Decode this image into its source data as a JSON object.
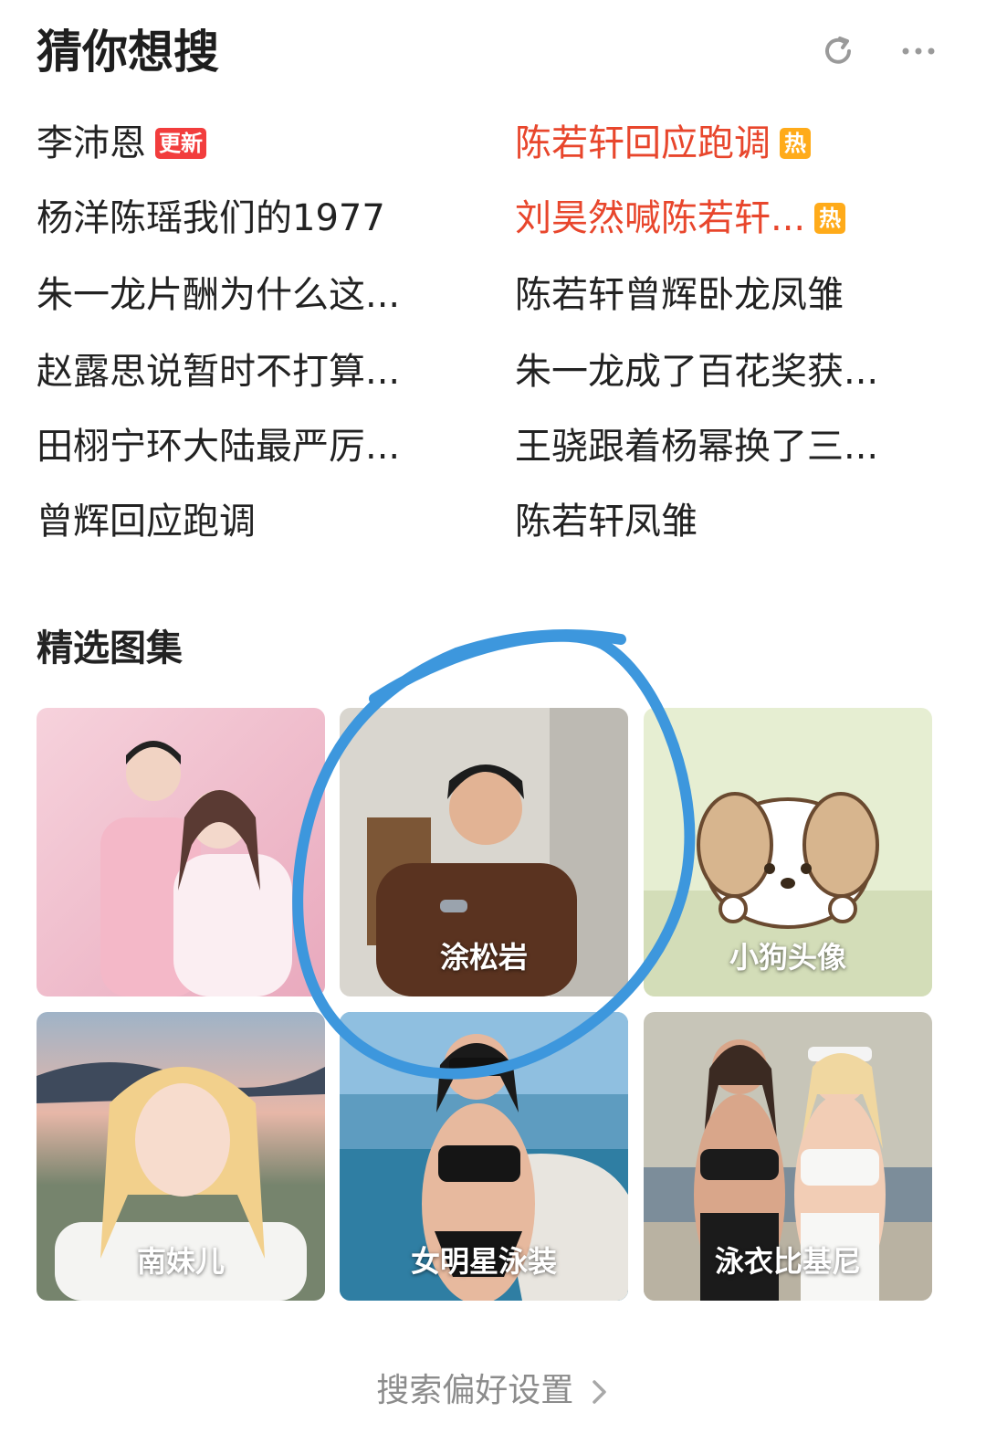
{
  "header": {
    "title": "猜你想搜",
    "refresh_icon": "refresh-icon",
    "more_icon": "more-icon"
  },
  "suggestions": {
    "left": [
      {
        "text": "李沛恩",
        "badge": "更新",
        "hot": false
      },
      {
        "text": "杨洋陈瑶我们的1977",
        "badge": "",
        "hot": false
      },
      {
        "text": "朱一龙片酬为什么这...",
        "badge": "",
        "hot": false
      },
      {
        "text": "赵露思说暂时不打算...",
        "badge": "",
        "hot": false
      },
      {
        "text": "田栩宁环大陆最严厉...",
        "badge": "",
        "hot": false
      },
      {
        "text": "曾辉回应跑调",
        "badge": "",
        "hot": false
      }
    ],
    "right": [
      {
        "text": "陈若轩回应跑调",
        "badge": "热",
        "hot": true
      },
      {
        "text": "刘昊然喊陈若轩...",
        "badge": "热",
        "hot": true
      },
      {
        "text": "陈若轩曾辉卧龙凤雏",
        "badge": "",
        "hot": false
      },
      {
        "text": "朱一龙成了百花奖获...",
        "badge": "",
        "hot": false
      },
      {
        "text": "王骁跟着杨幂换了三...",
        "badge": "",
        "hot": false
      },
      {
        "text": "陈若轩凤雏",
        "badge": "",
        "hot": false
      }
    ]
  },
  "gallery": {
    "title": "精选图集",
    "tiles": [
      {
        "label": ""
      },
      {
        "label": "涂松岩"
      },
      {
        "label": "小狗头像"
      },
      {
        "label": "南妹儿"
      },
      {
        "label": "女明星泳装"
      },
      {
        "label": "泳衣比基尼"
      }
    ]
  },
  "footer": {
    "preference": "搜索偏好设置",
    "chevron_icon": "chevron-right-icon"
  },
  "colors": {
    "hot_text": "#e8462c",
    "new_badge": "#f23d3d",
    "hot_badge": "#ffab1a",
    "annotation": "#3d97dd"
  }
}
